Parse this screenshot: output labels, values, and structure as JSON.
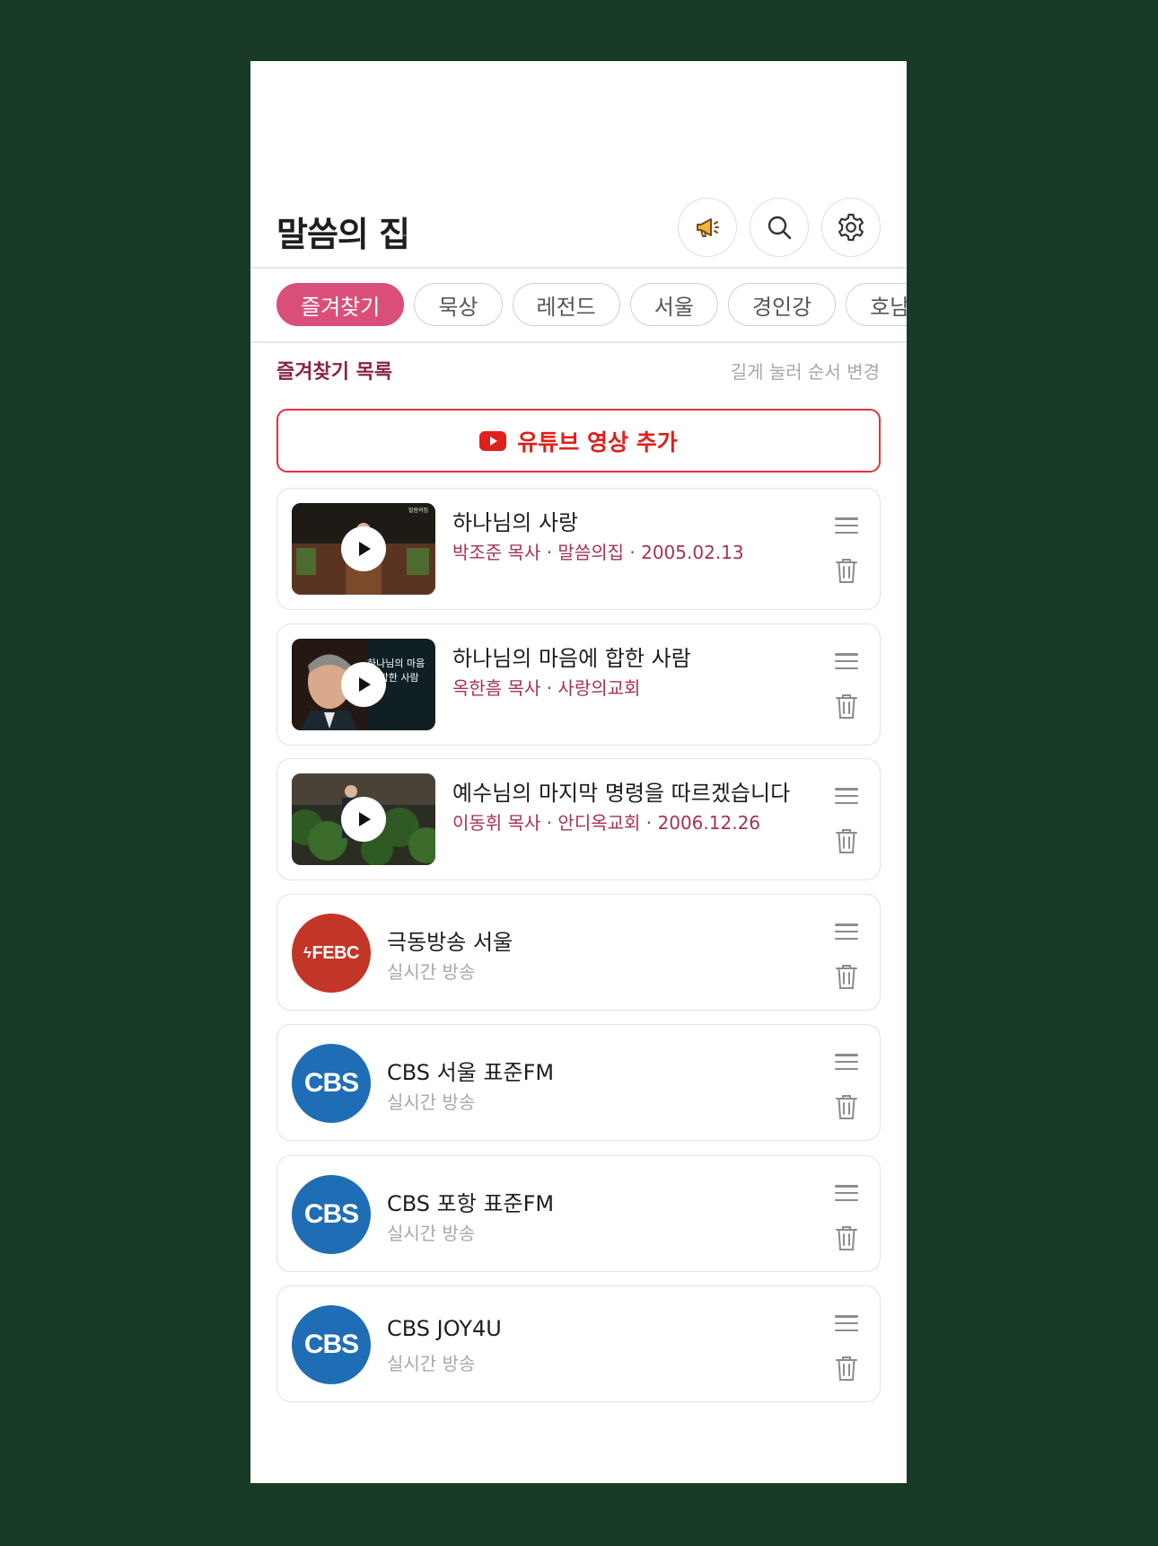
{
  "app": {
    "title": "말씀의 집"
  },
  "tabs": [
    {
      "label": "즐겨찾기",
      "active": true
    },
    {
      "label": "묵상",
      "active": false
    },
    {
      "label": "레전드",
      "active": false
    },
    {
      "label": "서울",
      "active": false
    },
    {
      "label": "경인강",
      "active": false
    },
    {
      "label": "호남",
      "active": false
    }
  ],
  "favorites": {
    "title": "즐겨찾기 목록",
    "hint": "길게 눌러 순서 변경",
    "add_youtube_label": "유튜브 영상 추가"
  },
  "videos": [
    {
      "title": "하나님의 사랑",
      "meta": "박조준 목사 · 말씀의집 · 2005.02.13"
    },
    {
      "title": "하나님의 마음에 합한 사람",
      "meta": "옥한흠 목사 · 사랑의교회",
      "thumb_text": "하나님의 마음에 합한 사람"
    },
    {
      "title": "예수님의 마지막 명령을 따르겠습니다",
      "meta": "이동휘 목사 · 안디옥교회 · 2006.12.26"
    }
  ],
  "radios": [
    {
      "name": "극동방송 서울",
      "sub": "실시간 방송",
      "logo": "FEBC"
    },
    {
      "name": "CBS 서울 표준FM",
      "sub": "실시간 방송",
      "logo": "CBS"
    },
    {
      "name": "CBS 포항 표준FM",
      "sub": "실시간 방송",
      "logo": "CBS"
    },
    {
      "name": "CBS JOY4U",
      "sub": "실시간 방송",
      "logo": "CBS"
    }
  ],
  "colors": {
    "background": "#183a26",
    "accent_pink": "#d94f7a",
    "youtube_red": "#e0201b",
    "meta_text": "#a6334f",
    "cbs_blue": "#1f6db5",
    "febc_red": "#c33526"
  },
  "icons": {
    "notice": "megaphone-icon",
    "search": "search-icon",
    "settings": "gear-icon",
    "reorder": "drag-handle-icon",
    "delete": "trash-icon",
    "play": "play-icon",
    "youtube": "youtube-icon"
  }
}
